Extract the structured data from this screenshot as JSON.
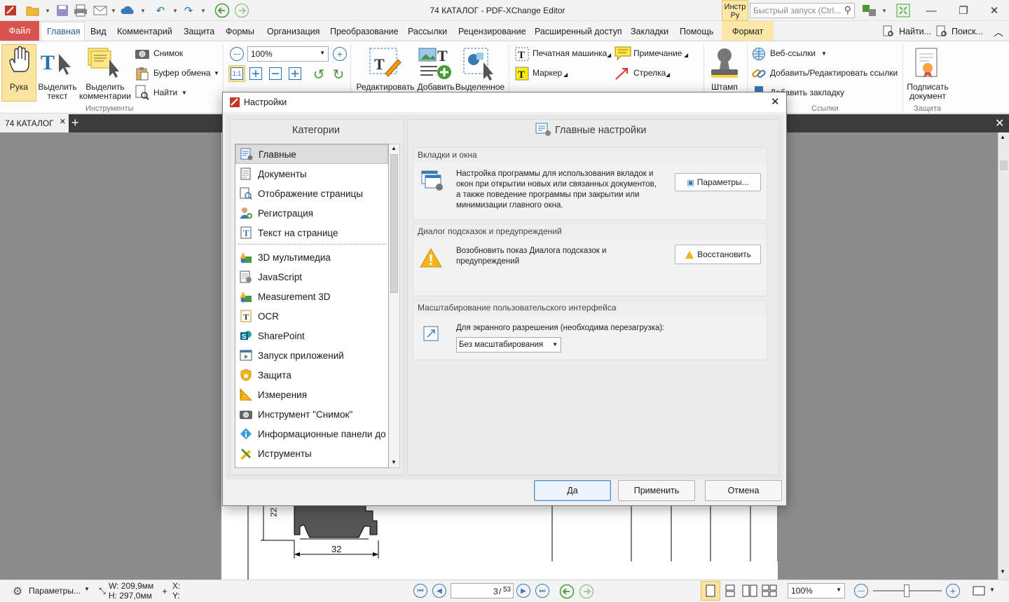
{
  "window": {
    "title": "74 КАТАЛОГ - PDF-XChange Editor",
    "tools_tab": "Инстр Ру",
    "quick_launch_placeholder": "Быстрый запуск (Ctrl...",
    "minimize": "—",
    "restore": "❐",
    "close": "✕"
  },
  "menu": {
    "file": "Файл",
    "items": [
      "Главная",
      "Вид",
      "Комментарий",
      "Защита",
      "Формы",
      "Организация",
      "Преобразование",
      "Рассылки",
      "Рецензирование",
      "Расширенный доступ",
      "Закладки",
      "Помощь",
      "Формат"
    ],
    "find": "Найти...",
    "search": "Поиск...",
    "collapse": "︿"
  },
  "ribbon": {
    "hand": "Рука",
    "select_text": [
      "Выделить",
      "текст"
    ],
    "select_comments": [
      "Выделить",
      "комментарии"
    ],
    "snapshot": "Снимок",
    "clipboard": "Буфер обмена",
    "find": "Найти",
    "group_tools": "Инструменты",
    "zoom": "100%",
    "edit": "Редактировать",
    "add": "Добавить",
    "selected": "Выделенное",
    "typewriter": "Печатная машинка",
    "marker": "Маркер",
    "note": "Примечание",
    "arrow": "Стрелка",
    "stamp": "Штамп",
    "web_links": "Веб-ссылки",
    "add_edit_links": "Добавить/Редактировать ссылки",
    "add_bookmark": "Добавить закладку",
    "group_links": "Ссылки",
    "sign": [
      "Подписать",
      "документ"
    ],
    "group_protect": "Защита"
  },
  "doc": {
    "tab": "74 КАТАЛОГ",
    "dimension_32": "32",
    "dimension_22": "22"
  },
  "status": {
    "options": "Параметры...",
    "width": "W: 209,9мм",
    "height": "H: 297,0мм",
    "x": "X:",
    "y": "Y:",
    "page": "3",
    "page_total": "53",
    "zoom": "100%"
  },
  "dialog": {
    "title": "Настройки",
    "categories_header": "Категории",
    "main_header": "Главные настройки",
    "categories": [
      {
        "label": "Главные",
        "icon": "settings-page-icon"
      },
      {
        "label": "Документы",
        "icon": "document-icon"
      },
      {
        "label": "Отображение страницы",
        "icon": "page-view-icon"
      },
      {
        "label": "Регистрация",
        "icon": "user-icon"
      },
      {
        "label": "Текст на странице",
        "icon": "text-icon"
      },
      {
        "label": "3D мультимедиа",
        "icon": "shapes-icon"
      },
      {
        "label": "JavaScript",
        "icon": "script-icon"
      },
      {
        "label": "Measurement 3D",
        "icon": "shapes-icon"
      },
      {
        "label": "OCR",
        "icon": "ocr-icon"
      },
      {
        "label": "SharePoint",
        "icon": "sharepoint-icon"
      },
      {
        "label": "Запуск приложений",
        "icon": "launch-icon"
      },
      {
        "label": "Защита",
        "icon": "shield-icon"
      },
      {
        "label": "Измерения",
        "icon": "ruler-icon"
      },
      {
        "label": "Инструмент \"Снимок\"",
        "icon": "camera-icon"
      },
      {
        "label": "Информационные панели до",
        "icon": "info-icon"
      },
      {
        "label": "Иструменты",
        "icon": "tools-icon"
      }
    ],
    "sections": {
      "tabs_windows": {
        "title": "Вкладки и окна",
        "text": [
          "Настройка программы для использования вкладок и",
          "окон при открытии новых или связанных документов,",
          "а также поведение программы при закрытии или",
          "минимизации главного окна."
        ],
        "button": "Параметры..."
      },
      "hints": {
        "title": "Диалог подсказок и предупреждений",
        "text": [
          "Возобновить показ Диалога подсказок и",
          "предупреждений"
        ],
        "button": "Восстановить"
      },
      "scaling": {
        "title": "Масштабирование пользовательского интерфейса",
        "label": "Для экранного разрешения (необходима перезагрузка):",
        "value": "Без масштабирования"
      }
    },
    "ok": "Да",
    "apply": "Применить",
    "cancel": "Отмена"
  }
}
